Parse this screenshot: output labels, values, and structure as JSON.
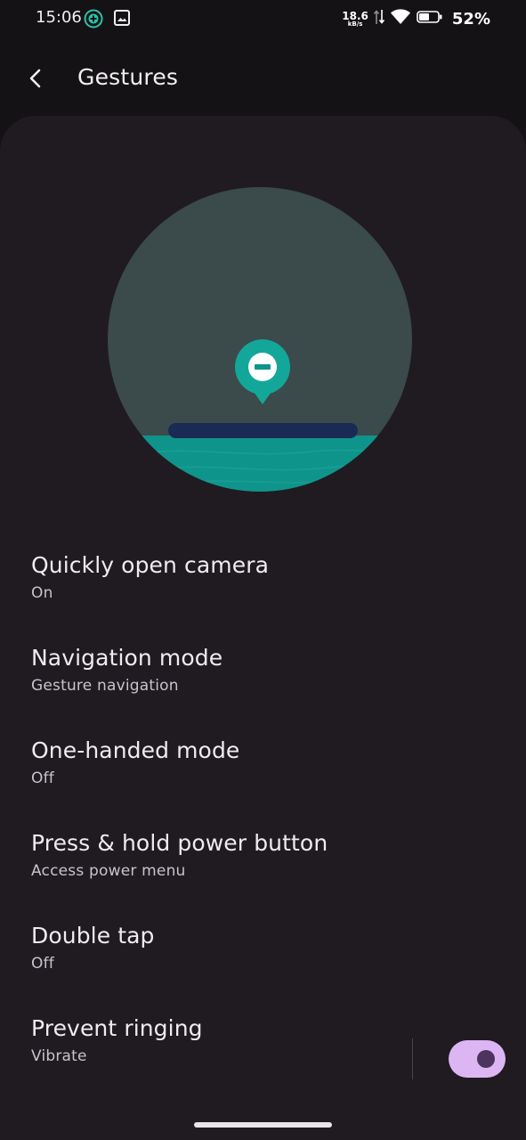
{
  "status_bar": {
    "time": "15:06",
    "net_speed_value": "18.6",
    "net_speed_unit": "kB/s",
    "battery_percent": "52%",
    "icons": [
      "vpn-shield-icon",
      "gallery-notification-icon",
      "network-arrows-icon",
      "wifi-icon",
      "battery-icon"
    ]
  },
  "header": {
    "title": "Gestures",
    "back_icon": "chevron-left-icon"
  },
  "illustration": {
    "colors": {
      "circle": "#3b4a4b",
      "water": "#0e948b",
      "bar": "#1b2a55",
      "pin": "#13a79a"
    }
  },
  "settings": [
    {
      "label": "Quickly open camera",
      "summary": "On"
    },
    {
      "label": "Navigation mode",
      "summary": "Gesture navigation"
    },
    {
      "label": "One-handed mode",
      "summary": "Off"
    },
    {
      "label": "Press & hold power button",
      "summary": "Access power menu"
    },
    {
      "label": "Double tap",
      "summary": "Off"
    },
    {
      "label": "Prevent ringing",
      "summary": "Vibrate",
      "toggle_on": true
    }
  ],
  "colors": {
    "background": "#151216",
    "card": "#1f1b20",
    "toggle_track": "#dcb6f3",
    "toggle_thumb": "#4d3360"
  }
}
